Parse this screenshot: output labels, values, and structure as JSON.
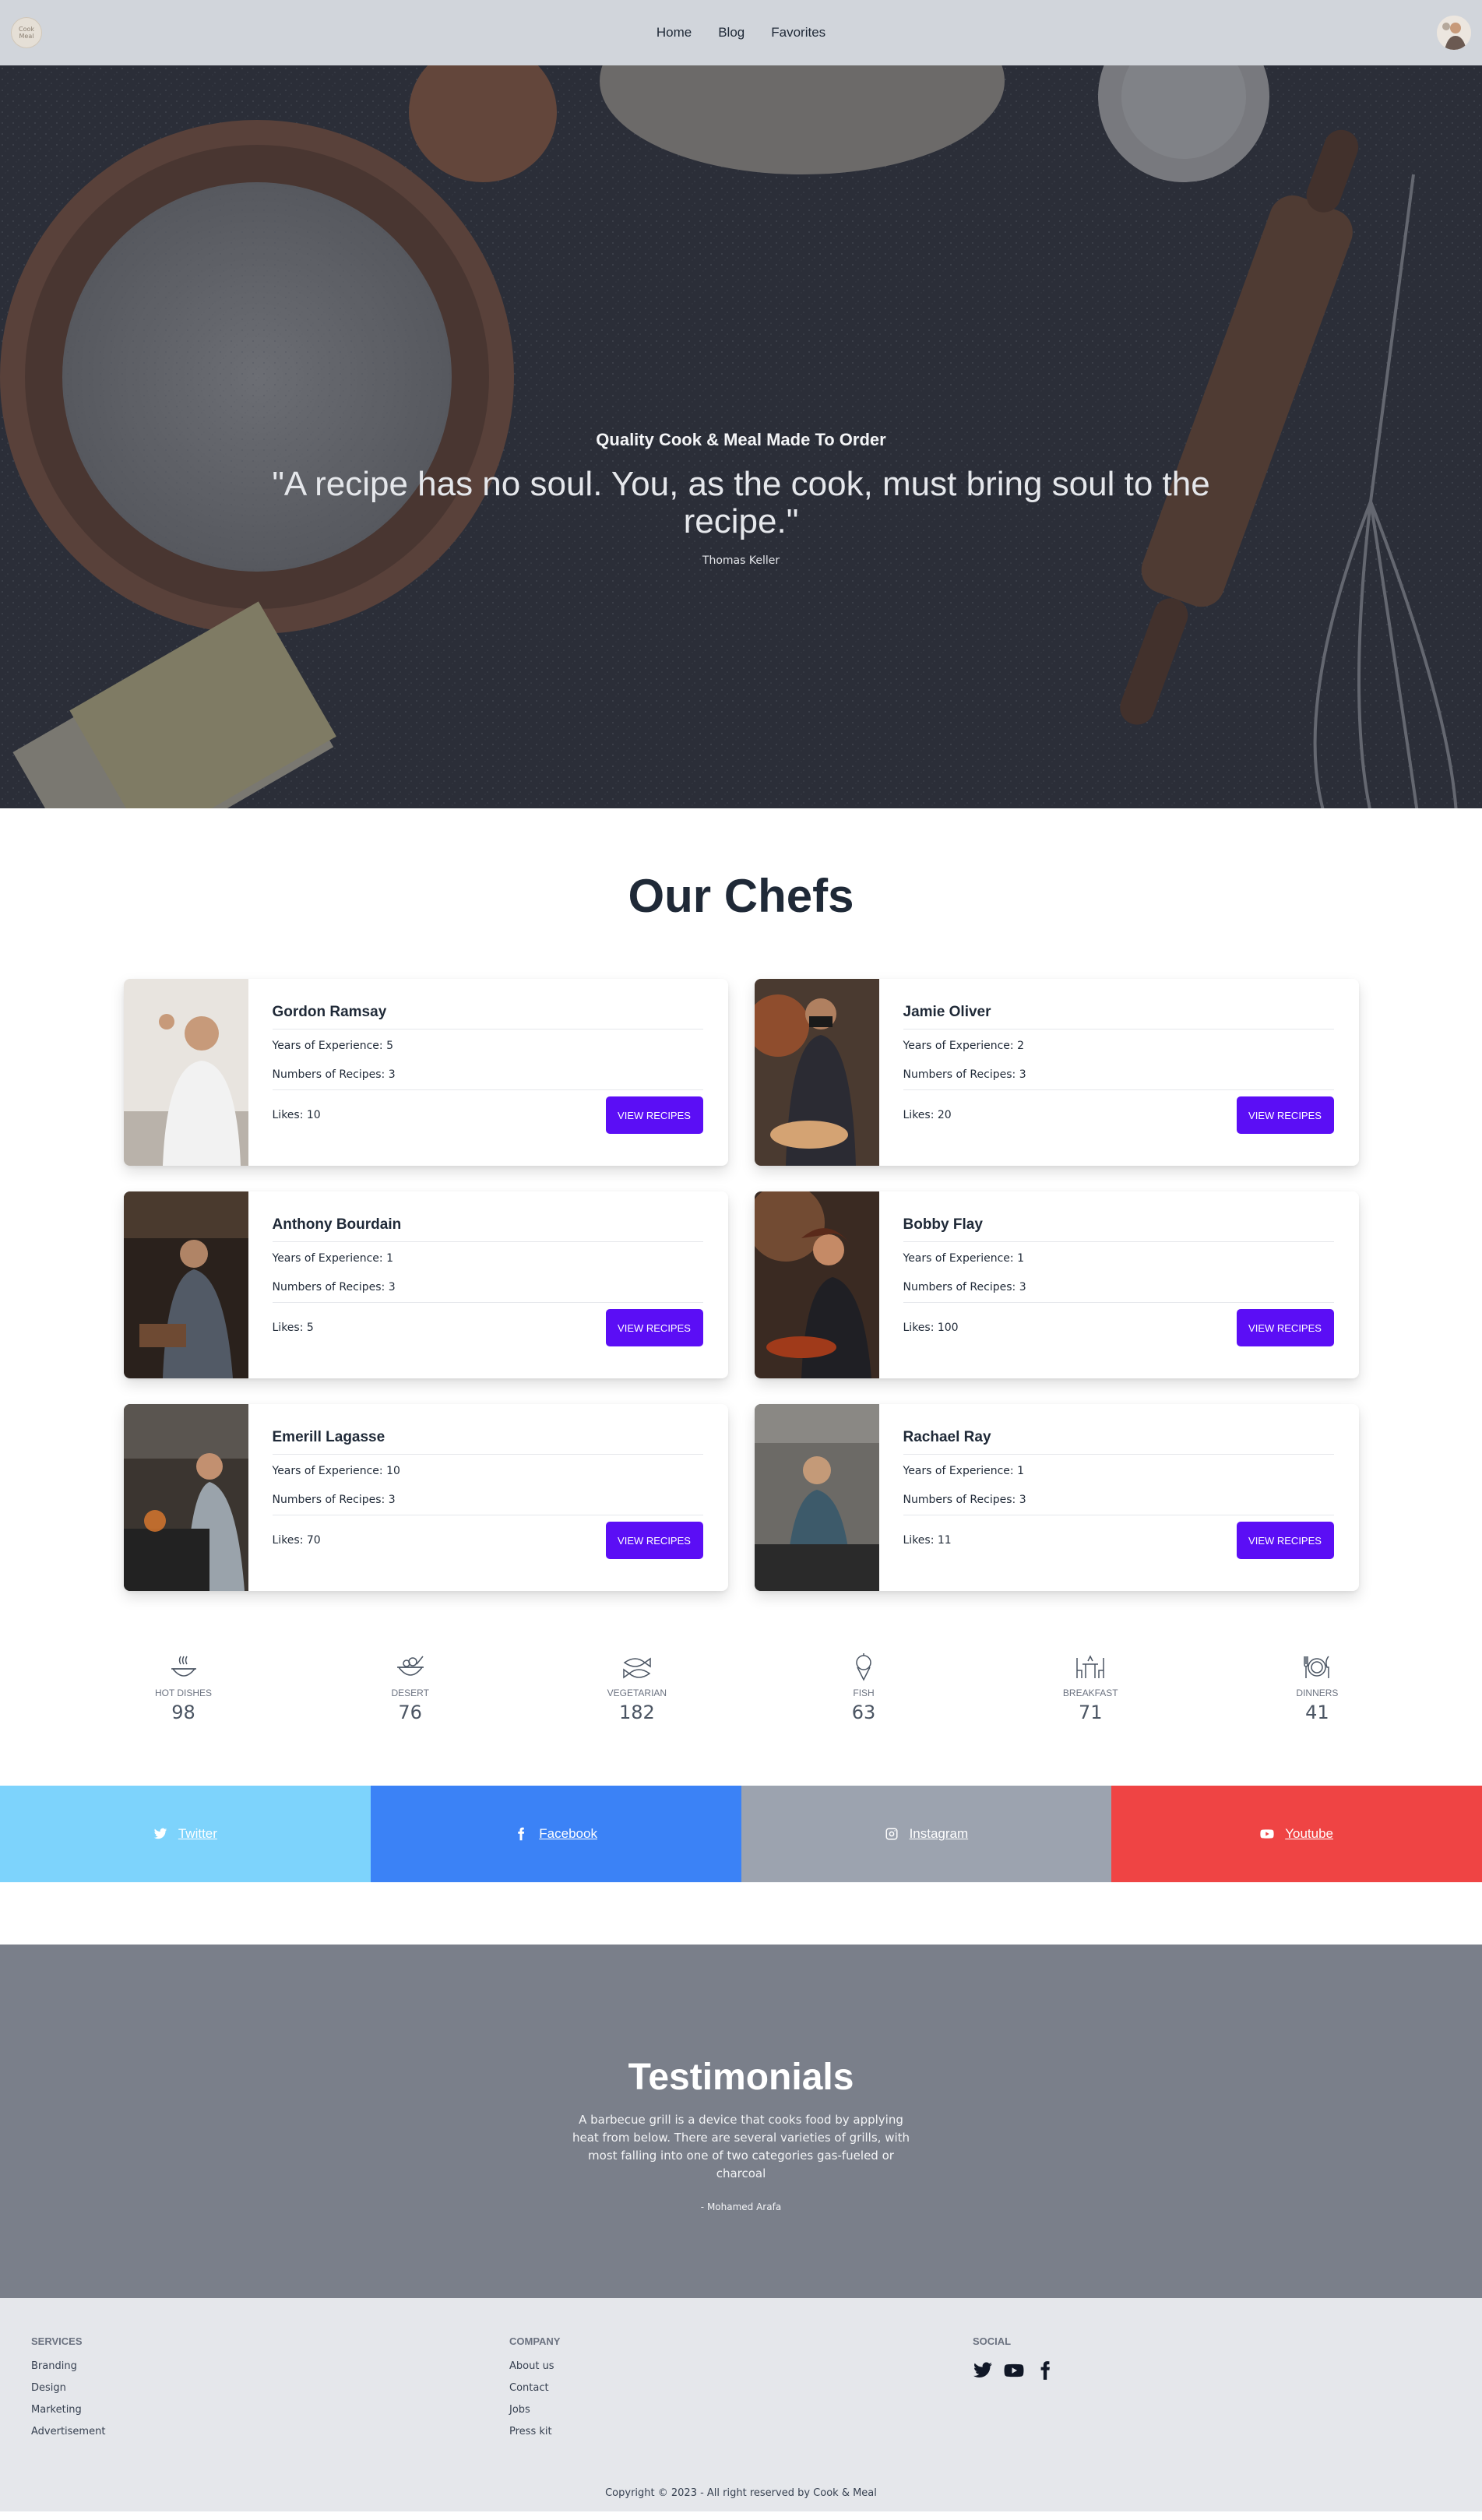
{
  "nav": {
    "logo_text": "Cook Meal",
    "links": [
      "Home",
      "Blog",
      "Favorites"
    ]
  },
  "hero": {
    "kicker": "Quality Cook & Meal Made To Order",
    "quote": "\"A recipe has no soul. You, as the cook, must bring soul to the recipe.\"",
    "author": "Thomas Keller"
  },
  "chefs": {
    "title": "Our Chefs",
    "button_label": "VIEW RECIPES",
    "items": [
      {
        "name": "Gordon Ramsay",
        "experience": "Years of Experience: 5",
        "recipes": "Numbers of Recipes: 3",
        "likes": "Likes: 10"
      },
      {
        "name": "Jamie Oliver",
        "experience": "Years of Experience: 2",
        "recipes": "Numbers of Recipes: 3",
        "likes": "Likes: 20"
      },
      {
        "name": "Anthony Bourdain",
        "experience": "Years of Experience: 1",
        "recipes": "Numbers of Recipes: 3",
        "likes": "Likes: 5"
      },
      {
        "name": "Bobby Flay",
        "experience": "Years of Experience: 1",
        "recipes": "Numbers of Recipes: 3",
        "likes": "Likes: 100"
      },
      {
        "name": "Emerill Lagasse",
        "experience": "Years of Experience: 10",
        "recipes": "Numbers of Recipes: 3",
        "likes": "Likes: 70"
      },
      {
        "name": "Rachael Ray",
        "experience": "Years of Experience: 1",
        "recipes": "Numbers of Recipes: 3",
        "likes": "Likes: 11"
      }
    ]
  },
  "categories": [
    {
      "label": "HOT DISHES",
      "count": "98",
      "icon": "hot-dish-icon"
    },
    {
      "label": "DESERT",
      "count": "76",
      "icon": "dessert-bowl-icon"
    },
    {
      "label": "VEGETARIAN",
      "count": "182",
      "icon": "fish-pair-icon"
    },
    {
      "label": "FISH",
      "count": "63",
      "icon": "ice-cream-icon"
    },
    {
      "label": "BREAKFAST",
      "count": "71",
      "icon": "table-chairs-icon"
    },
    {
      "label": "DINNERS",
      "count": "41",
      "icon": "plate-cutlery-icon"
    }
  ],
  "social": {
    "twitter": "Twitter",
    "facebook": "Facebook",
    "instagram": "Instagram",
    "youtube": "Youtube"
  },
  "testimonials": {
    "title": "Testimonials",
    "text": "A barbecue grill is a device that cooks food by applying heat from below. There are several varieties of grills, with most falling into one of two categories gas-fueled or charcoal",
    "author": "- Mohamed Arafa"
  },
  "footer": {
    "services": {
      "heading": "SERVICES",
      "links": [
        "Branding",
        "Design",
        "Marketing",
        "Advertisement"
      ]
    },
    "company": {
      "heading": "COMPANY",
      "links": [
        "About us",
        "Contact",
        "Jobs",
        "Press kit"
      ]
    },
    "social_heading": "SOCIAL",
    "copyright": "Copyright © 2023 - All right reserved by Cook & Meal"
  },
  "colors": {
    "accent": "#5b0ef5",
    "twitter": "#7dd3fc",
    "facebook": "#3b82f6",
    "instagram": "#9ca3af",
    "youtube": "#ef4444",
    "testimonials_bg": "#7a7f8a",
    "nav_bg": "#d1d5db",
    "footer_bg": "#e5e7eb"
  }
}
